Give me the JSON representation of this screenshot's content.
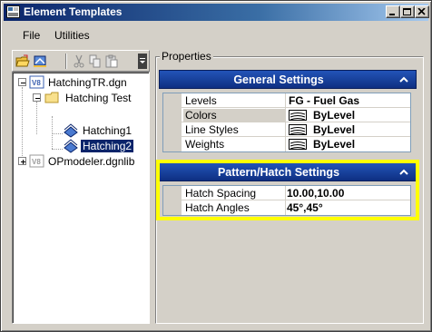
{
  "window": {
    "title": "Element Templates",
    "icon": "app-icon",
    "buttons": [
      "minimize-icon",
      "maximize-icon",
      "close-icon"
    ]
  },
  "menu": {
    "file": "File",
    "utilities": "Utilities"
  },
  "toolbar": {
    "icons": [
      "open-folder-icon",
      "library-icon",
      "cut-icon",
      "copy-icon",
      "paste-icon",
      "overflow-chevron-icon"
    ]
  },
  "tree": {
    "root_file": "HatchingTR.dgn",
    "group": "Hatching Test",
    "item1": "Hatching1",
    "item2": "Hatching2",
    "library": "OPmodeler.dgnlib"
  },
  "properties": {
    "legend": "Properties",
    "general": {
      "title": "General Settings",
      "rows": [
        {
          "name": "Levels",
          "value": "FG - Fuel Gas",
          "swatch": false
        },
        {
          "name": "Colors",
          "value": "ByLevel",
          "swatch": true
        },
        {
          "name": "Line Styles",
          "value": "ByLevel",
          "swatch": true
        },
        {
          "name": "Weights",
          "value": "ByLevel",
          "swatch": true
        }
      ]
    },
    "hatch": {
      "title": "Pattern/Hatch Settings",
      "rows": [
        {
          "name": "Hatch Spacing",
          "value": "10.00,10.00"
        },
        {
          "name": "Hatch Angles",
          "value": "45°,45°"
        }
      ]
    }
  },
  "colors": {
    "titlebar": "#0a246a",
    "panel_header": "#0e2f82",
    "highlight": "#ffff00",
    "selection": "#0a246a"
  }
}
